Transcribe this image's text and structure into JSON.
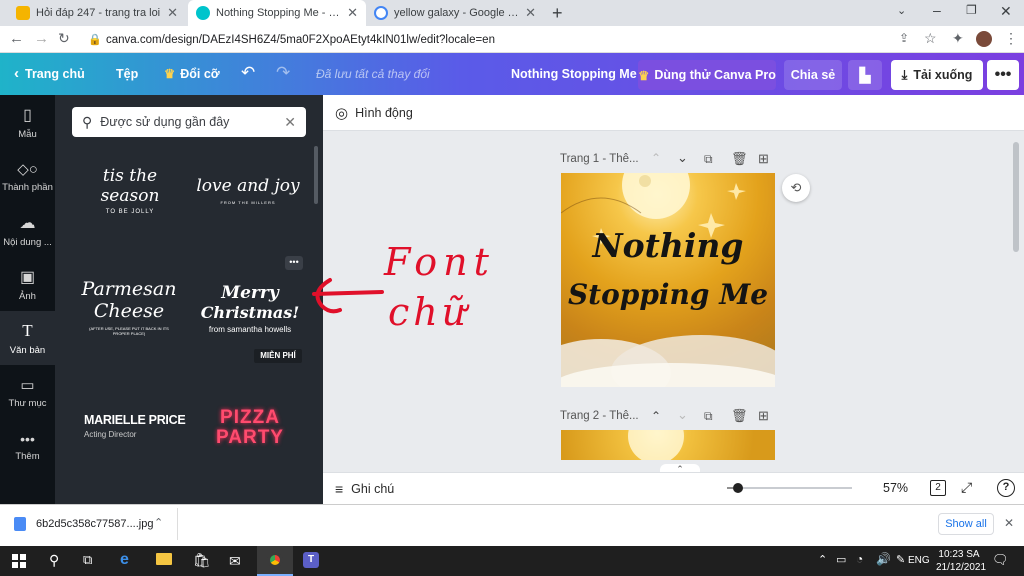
{
  "browser": {
    "tabs": [
      {
        "title": "Hỏi đáp 247 - trang tra loi",
        "active": false,
        "favicon_color": "#f5b400"
      },
      {
        "title": "Nothing Stopping Me - Logo",
        "active": true,
        "favicon_color": "#00c4cc"
      },
      {
        "title": "yellow galaxy - Google Tìm kiếm",
        "active": false,
        "favicon_color": "#4285f4"
      }
    ],
    "url": "canva.com/design/DAEzI4SH6Z4/5ma0F2XpoAEtyt4kIN01lw/edit?locale=en"
  },
  "header": {
    "home_label": "Trang chủ",
    "file_label": "Tệp",
    "resize_label": "Đổi cỡ",
    "saved_status": "Đã lưu tất cả thay đổi",
    "design_title": "Nothing Stopping Me",
    "try_pro_label": "Dùng thử Canva Pro",
    "share_label": "Chia sẻ",
    "download_label": "Tải xuống",
    "accent_pro": "#7b4fe0"
  },
  "rail": {
    "items": [
      {
        "label": "Mẫu",
        "icon": "templates-icon"
      },
      {
        "label": "Thành phần",
        "icon": "elements-icon"
      },
      {
        "label": "Nội dung ...",
        "icon": "uploads-icon"
      },
      {
        "label": "Ảnh",
        "icon": "photos-icon"
      },
      {
        "label": "Văn bản",
        "icon": "text-icon"
      },
      {
        "label": "Thư mục",
        "icon": "folder-icon"
      },
      {
        "label": "Thêm",
        "icon": "more-icon"
      }
    ]
  },
  "panel": {
    "search_placeholder": "Được sử dụng gần đây",
    "templates": [
      {
        "line1": "tis the season",
        "line2": "TO BE JOLLY"
      },
      {
        "line1": "love and joy",
        "line2": "FROM THE MILLERS"
      },
      {
        "line1": "Parmesan",
        "line2": "Cheese",
        "line3": "(AFTER USE, PLEASE PUT IT BACK IN ITS PROPER PLACE)"
      },
      {
        "line1": "Merry",
        "line2": "Christmas!",
        "line3": "from samantha howells",
        "badge": "MIỄN PHÍ"
      },
      {
        "line1": "MARIELLE PRICE",
        "line2": "Acting Director"
      },
      {
        "line1": "PIZZA",
        "line2": "PARTY"
      }
    ]
  },
  "annotation": {
    "line1": "Font",
    "line2": "chữ",
    "color": "#e0102a"
  },
  "editor": {
    "animate_label": "Hình động",
    "page1_label": "Trang 1 - Thê...",
    "page2_label": "Trang 2 - Thê...",
    "design_text_line1": "Nothing",
    "design_text_line2": "Stopping Me",
    "notes_label": "Ghi chú",
    "zoom": "57%",
    "page_count": "2"
  },
  "downloads": {
    "file_name": "6b2d5c358c77587....jpg",
    "show_all_label": "Show all"
  },
  "taskbar": {
    "language": "ENG",
    "time": "10:23 SA",
    "date": "21/12/2021"
  }
}
